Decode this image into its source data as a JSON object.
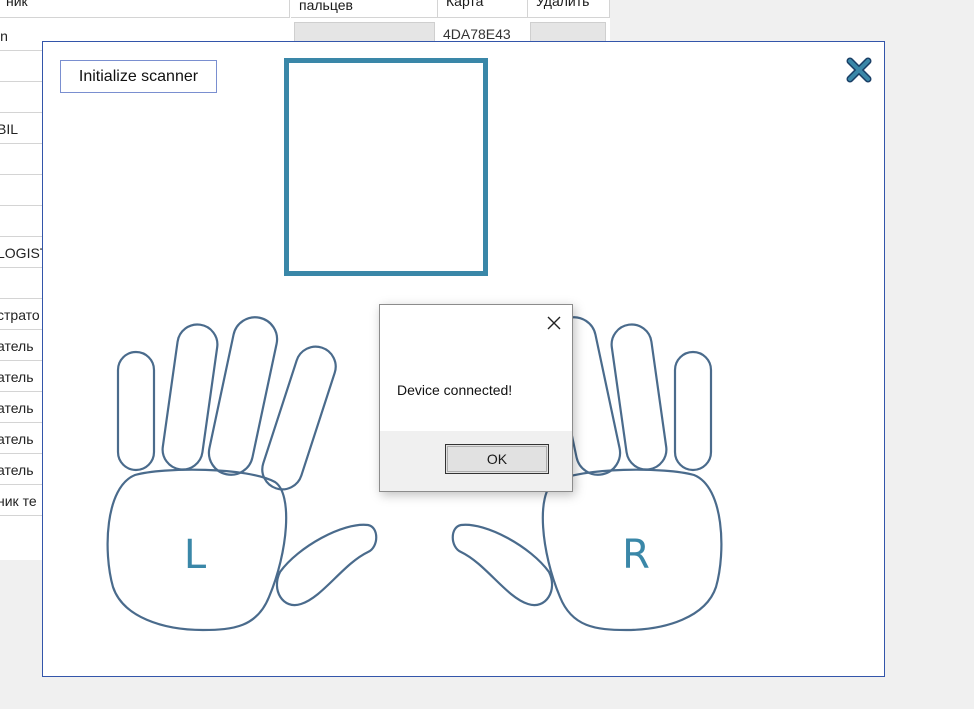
{
  "background_table": {
    "headers": [
      "ник",
      "пальцев",
      "Карта",
      "Удалить"
    ],
    "first_card": "4DA78E43",
    "rows": [
      "in",
      "",
      "",
      "BIL",
      "",
      "",
      "",
      "LOGIST",
      "",
      "страто",
      "атель",
      "атель",
      "атель",
      "атель",
      "атель",
      "ник те"
    ]
  },
  "scanner": {
    "init_button": "Initialize scanner",
    "left_hand_label": "L",
    "right_hand_label": "R",
    "accent_color": "#3a87a8",
    "close_icon": "close-x-icon"
  },
  "dialog": {
    "message": "Device connected!",
    "ok_label": "OK"
  }
}
